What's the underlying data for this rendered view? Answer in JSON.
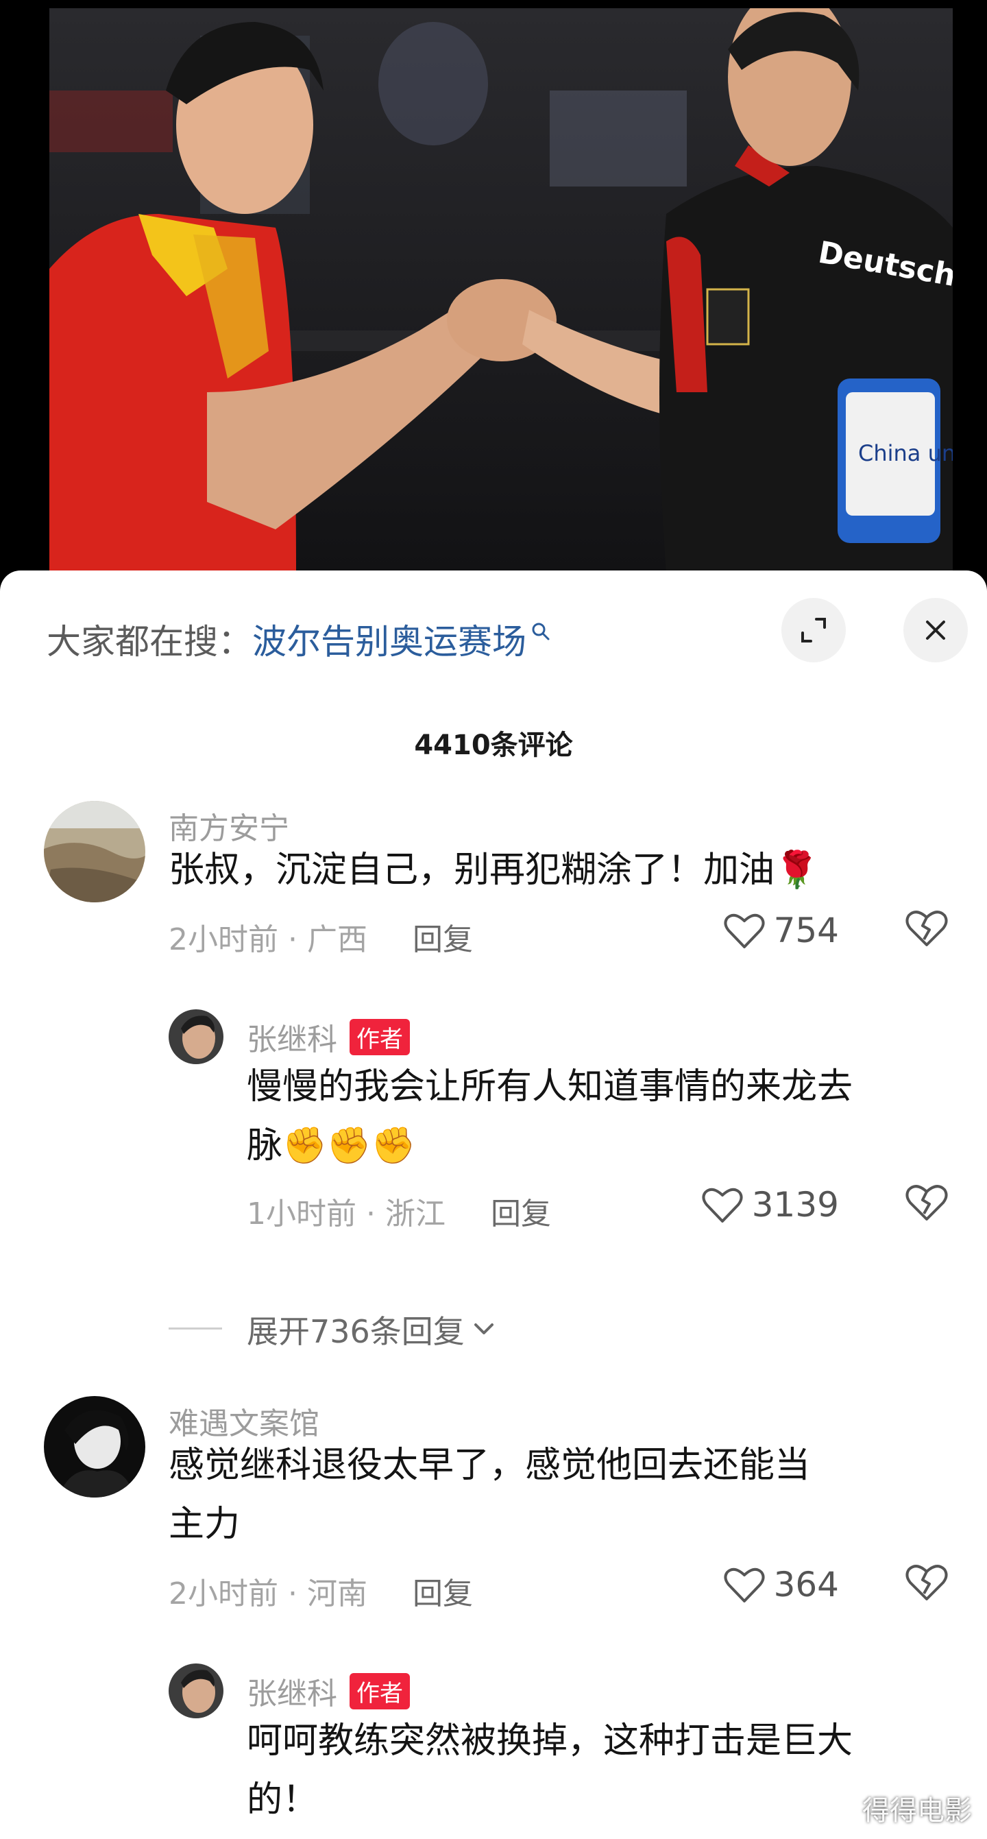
{
  "photo": {
    "jersey_text": "Deutschland",
    "badge_text": "China unicom"
  },
  "search": {
    "prefix": "大家都在搜：",
    "term": "波尔告别奥运赛场"
  },
  "comment_count": "4410条评论",
  "comments": [
    {
      "name": "南方安宁",
      "text": "张叔，沉淀自己，别再犯糊涂了！加油🌹",
      "time": "2小时前 · 广西",
      "reply": "回复",
      "likes": "754"
    },
    {
      "name": "张继科",
      "badge": "作者",
      "text1": "慢慢的我会让所有人知道事情的来龙去",
      "text2": "脉✊✊✊",
      "time": "1小时前 · 浙江",
      "reply": "回复",
      "likes": "3139"
    },
    {
      "name": "难遇文案馆",
      "text1": "感觉继科退役太早了，感觉他回去还能当",
      "text2": "主力",
      "time": "2小时前 · 河南",
      "reply": "回复",
      "likes": "364"
    },
    {
      "name": "张继科",
      "badge": "作者",
      "text1": "呵呵教练突然被换掉，这种打击是巨大",
      "text2": "的！"
    }
  ],
  "expand_replies": "展开736条回复",
  "watermark": "得得电影",
  "colors": {
    "search_term": "#2b5d9c",
    "author_badge": "#f0233c",
    "red_jersey": "#d8241c",
    "black_jersey": "#161616"
  }
}
